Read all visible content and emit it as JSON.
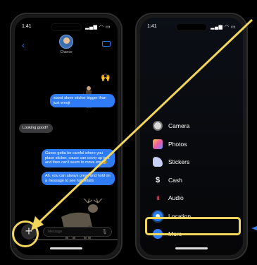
{
  "left_phone": {
    "time": "1:41",
    "status_icons": "signal wifi battery",
    "contact_name": "Chance",
    "messages": [
      {
        "text": "stand alone sticker bigger than just emoji",
        "side": "sent"
      },
      {
        "text": "Looking good!!",
        "side": "received"
      },
      {
        "text": "Guess gotta be careful where you place sticker, cause can cover up text and then can't seem to move em 😅",
        "side": "sent"
      },
      {
        "text": "Ah, you can always press and hold on a message to see full details",
        "side": "sent"
      }
    ],
    "input_placeholder": "Message",
    "plus_label": "+"
  },
  "right_phone": {
    "time": "1:41",
    "status_icons": "signal wifi battery",
    "menu": [
      {
        "label": "Camera",
        "icon": "camera-icon"
      },
      {
        "label": "Photos",
        "icon": "photos-icon"
      },
      {
        "label": "Stickers",
        "icon": "stickers-icon"
      },
      {
        "label": "Cash",
        "icon": "cash-icon"
      },
      {
        "label": "Audio",
        "icon": "audio-icon"
      },
      {
        "label": "Location",
        "icon": "location-icon"
      },
      {
        "label": "More",
        "icon": "more-icon"
      }
    ]
  },
  "colors": {
    "highlight": "#f2d65b",
    "imessage_blue": "#2f7cf6",
    "received_gray": "#3a3a3c"
  }
}
